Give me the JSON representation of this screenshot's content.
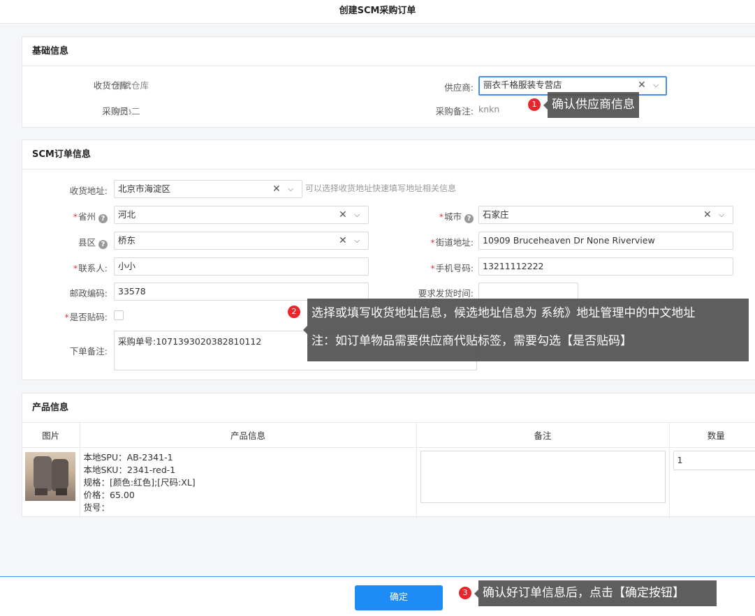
{
  "page": {
    "title": "创建SCM采购订单"
  },
  "basic": {
    "title": "基础信息",
    "warehouse_label": "收货仓库:",
    "warehouse_value": "测试仓库",
    "buyer_label": "采购员:",
    "buyer_value": "刘小二",
    "supplier_label": "供应商:",
    "supplier_value": "丽衣千格服装专营店",
    "remark_label": "采购备注:",
    "remark_value": "knkn"
  },
  "scm": {
    "title": "SCM订单信息",
    "address_label": "收货地址:",
    "address_value": "北京市海淀区",
    "address_hint": "可以选择收货地址快速填写地址相关信息",
    "province_label": "省州",
    "province_value": "河北",
    "city_label": "城市",
    "city_value": "石家庄",
    "district_label": "县区",
    "district_value": "桥东",
    "street_label": "街道地址:",
    "street_value": "10909 Bruceheaven Dr None Riverview",
    "contact_label": "联系人:",
    "contact_value": "小小",
    "phone_label": "手机号码:",
    "phone_value": "13211112222",
    "zip_label": "邮政编码:",
    "zip_value": "33578",
    "ship_time_label": "要求发货时间:",
    "ship_time_value": "",
    "label_code_label": "是否贴码:",
    "order_remark_label": "下单备注:",
    "order_remark_value": "采购单号:1071393020382810112"
  },
  "products": {
    "title": "产品信息",
    "columns": [
      "图片",
      "产品信息",
      "备注",
      "数量"
    ],
    "rows": [
      {
        "spu": "本地SPU：AB-2341-1",
        "sku": "本地SKU：2341-red-1",
        "spec": "规格：[颜色:红色];[尺码:XL]",
        "price": "价格：65.00",
        "item_no": "货号：",
        "note": "",
        "qty": "1"
      }
    ]
  },
  "tips": {
    "t1_num": "1",
    "t1_text": "确认供应商信息",
    "t2_num": "2",
    "t2_line1": "选择或填写收货地址信息，候选地址信息为 系统》地址管理中的中文地址",
    "t2_line2": "注：如订单物品需要供应商代贴标签，需要勾选【是否贴码】",
    "t3_num": "3",
    "t3_text": "确认好订单信息后，点击【确定按钮】"
  },
  "footer": {
    "confirm_label": "确定"
  },
  "icons": {
    "clear": "close-icon",
    "dropdown": "chevron-down-icon",
    "help": "question-icon"
  },
  "colors": {
    "primary": "#1e8cf5",
    "required": "#e33333",
    "badge": "#e8262c"
  }
}
